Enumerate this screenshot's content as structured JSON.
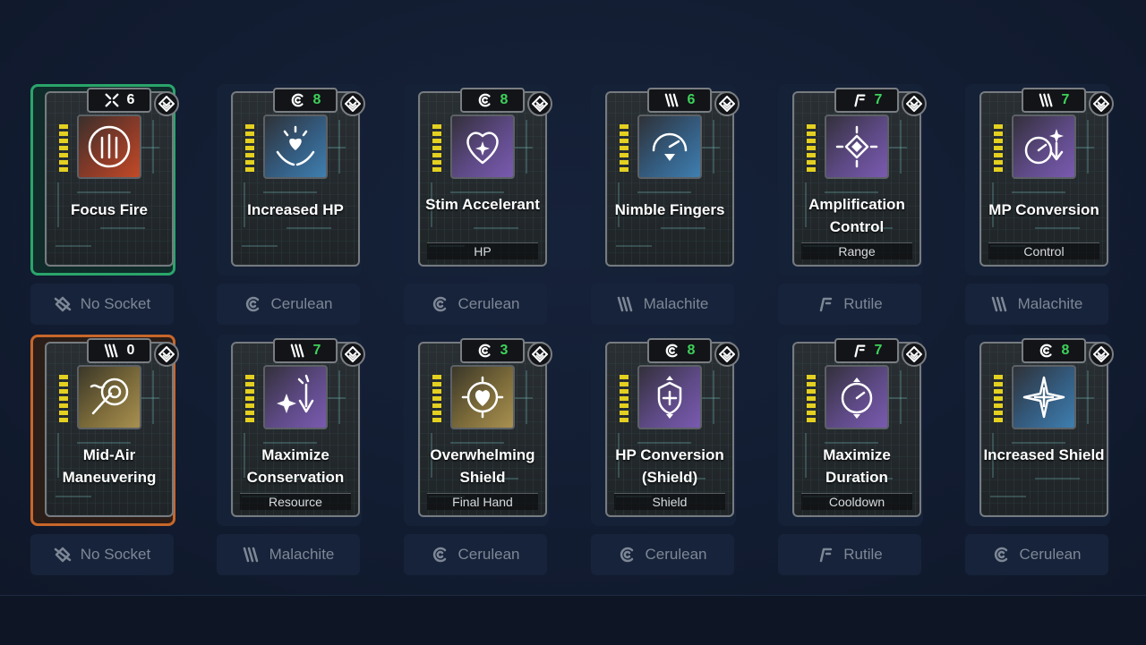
{
  "colors": {
    "cost_green": "#3ed25a",
    "selected_green": "#2aa56b",
    "selected_orange": "#c8672a",
    "background": "#111a2c"
  },
  "cards": [
    {
      "title": "Focus Fire",
      "cost": "6",
      "cost_color": "white",
      "cost_icon": "cross-arrows-icon",
      "art": "red",
      "art_icon": "ammo-rounds-icon",
      "tag": "",
      "socket": "No Socket",
      "socket_icon": "no-socket-icon",
      "selected": "green"
    },
    {
      "title": "Increased HP",
      "cost": "8",
      "cost_color": "green",
      "cost_icon": "cerulean-icon",
      "art": "blue",
      "art_icon": "heart-hands-icon",
      "tag": "",
      "socket": "Cerulean",
      "socket_icon": "cerulean-icon",
      "selected": ""
    },
    {
      "title": "Stim Accelerant",
      "cost": "8",
      "cost_color": "green",
      "cost_icon": "cerulean-icon",
      "art": "purple",
      "art_icon": "heart-sparkle-icon",
      "tag": "HP",
      "socket": "Cerulean",
      "socket_icon": "cerulean-icon",
      "selected": ""
    },
    {
      "title": "Nimble Fingers",
      "cost": "6",
      "cost_color": "green",
      "cost_icon": "malachite-icon",
      "art": "blue",
      "art_icon": "gauge-down-icon",
      "tag": "",
      "socket": "Malachite",
      "socket_icon": "malachite-icon",
      "selected": ""
    },
    {
      "title": "Amplification Control",
      "cost": "7",
      "cost_color": "green",
      "cost_icon": "rutile-icon",
      "art": "purple",
      "art_icon": "diamond-burst-icon",
      "tag": "Range",
      "socket": "Rutile",
      "socket_icon": "rutile-icon",
      "selected": ""
    },
    {
      "title": "MP Conversion",
      "cost": "7",
      "cost_color": "green",
      "cost_icon": "malachite-icon",
      "art": "purple",
      "art_icon": "gauge-arrow-icon",
      "tag": "Control",
      "socket": "Malachite",
      "socket_icon": "malachite-icon",
      "selected": ""
    },
    {
      "title": "Mid-Air Maneuvering",
      "cost": "0",
      "cost_color": "white",
      "cost_icon": "malachite-icon",
      "art": "gold",
      "art_icon": "target-shot-icon",
      "tag": "",
      "socket": "No Socket",
      "socket_icon": "no-socket-icon",
      "selected": "orange"
    },
    {
      "title": "Maximize Conservation",
      "cost": "7",
      "cost_color": "green",
      "cost_icon": "malachite-icon",
      "art": "purple",
      "art_icon": "sparkle-down-icon",
      "tag": "Resource",
      "socket": "Malachite",
      "socket_icon": "malachite-icon",
      "selected": ""
    },
    {
      "title": "Overwhelming Shield",
      "cost": "3",
      "cost_color": "green",
      "cost_icon": "cerulean-icon",
      "art": "gold",
      "art_icon": "heart-shield-icon",
      "tag": "Final Hand",
      "socket": "Cerulean",
      "socket_icon": "cerulean-icon",
      "selected": ""
    },
    {
      "title": "HP Conversion (Shield)",
      "cost": "8",
      "cost_color": "green",
      "cost_icon": "cerulean-icon",
      "art": "purple",
      "art_icon": "shield-cycle-icon",
      "tag": "Shield",
      "socket": "Cerulean",
      "socket_icon": "cerulean-icon",
      "selected": ""
    },
    {
      "title": "Maximize Duration",
      "cost": "7",
      "cost_color": "green",
      "cost_icon": "rutile-icon",
      "art": "purple",
      "art_icon": "timer-cycle-icon",
      "tag": "Cooldown",
      "socket": "Rutile",
      "socket_icon": "rutile-icon",
      "selected": ""
    },
    {
      "title": "Increased Shield",
      "cost": "8",
      "cost_color": "green",
      "cost_icon": "cerulean-icon",
      "art": "blue",
      "art_icon": "cross-star-icon",
      "tag": "",
      "socket": "Cerulean",
      "socket_icon": "cerulean-icon",
      "selected": ""
    }
  ]
}
